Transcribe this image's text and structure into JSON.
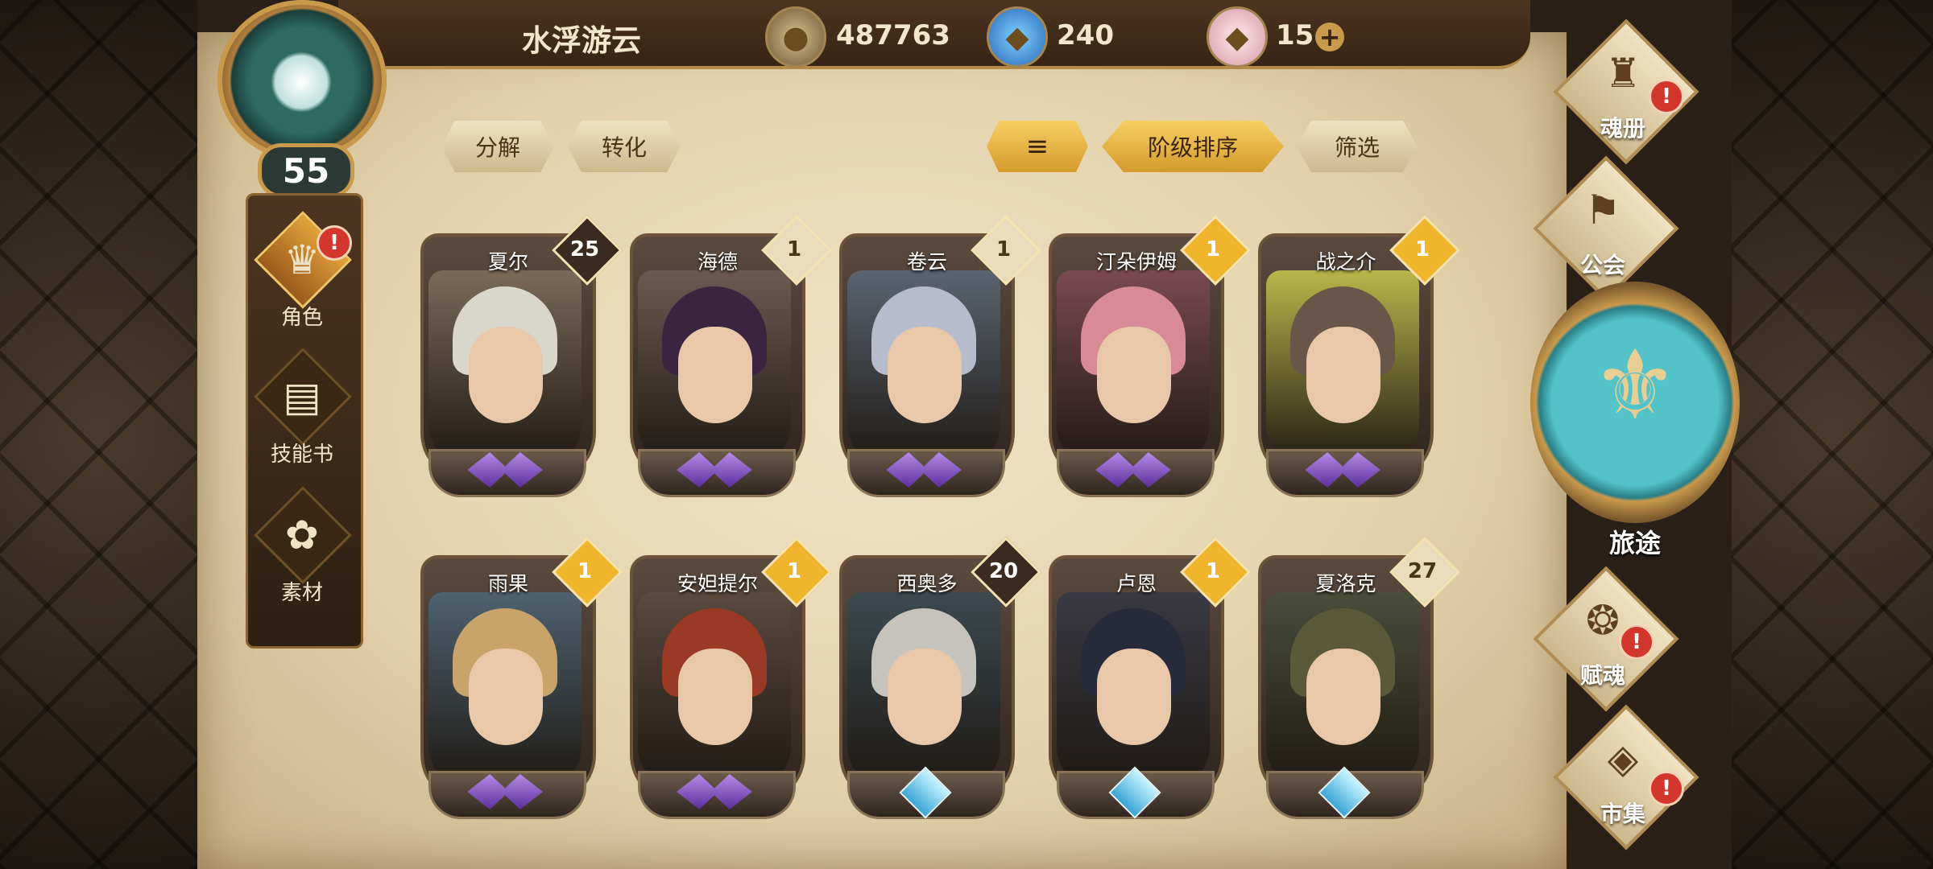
{
  "player": {
    "name": "水浮游云",
    "level": "55"
  },
  "currencies": [
    {
      "icon": "gold-coin-icon",
      "value": "487763"
    },
    {
      "icon": "blue-crystal-icon",
      "value": "240"
    },
    {
      "icon": "pink-gem-icon",
      "value": "15"
    }
  ],
  "left_nav": [
    {
      "label": "角色",
      "icon": "helmet-icon",
      "active": true,
      "alert": true
    },
    {
      "label": "技能书",
      "icon": "book-icon",
      "active": false,
      "alert": false
    },
    {
      "label": "素材",
      "icon": "material-icon",
      "active": false,
      "alert": false
    }
  ],
  "toolbar": {
    "decompose": "分解",
    "convert": "转化",
    "sort_icon": "sort-icon",
    "sort_by_rank": "阶级排序",
    "filter": "筛选"
  },
  "cards": [
    {
      "name": "夏尔",
      "rank": "25",
      "rank_color": "#3a2a20",
      "gem": "purple",
      "hair": "#d9d6cc",
      "bg": "#7a6a58"
    },
    {
      "name": "海德",
      "rank": "1",
      "rank_color": "#e9dcbc",
      "gem": "purple",
      "hair": "#3a2440",
      "bg": "#6c5a52"
    },
    {
      "name": "卷云",
      "rank": "1",
      "rank_color": "#e9dcbc",
      "gem": "purple",
      "hair": "#b7bccc",
      "bg": "#5a6470"
    },
    {
      "name": "汀朵伊姆",
      "rank": "1",
      "rank_color": "#f0b52c",
      "gem": "purple",
      "hair": "#d88a96",
      "bg": "#7a4a52"
    },
    {
      "name": "战之介",
      "rank": "1",
      "rank_color": "#f0b52c",
      "gem": "purple",
      "hair": "#6a5648",
      "bg": "#b9b64a"
    },
    {
      "name": "雨果",
      "rank": "1",
      "rank_color": "#f0b52c",
      "gem": "purple",
      "hair": "#c9a46a",
      "bg": "#4e6270"
    },
    {
      "name": "安妲提尔",
      "rank": "1",
      "rank_color": "#f0b52c",
      "gem": "purple",
      "hair": "#9a3a24",
      "bg": "#5a4a40"
    },
    {
      "name": "西奥多",
      "rank": "20",
      "rank_color": "#3a2a20",
      "gem": "blue",
      "hair": "#c6c2bc",
      "bg": "#3c4a50"
    },
    {
      "name": "卢恩",
      "rank": "1",
      "rank_color": "#f0b52c",
      "gem": "blue",
      "hair": "#262a3a",
      "bg": "#3a3a44"
    },
    {
      "name": "夏洛克",
      "rank": "27",
      "rank_color": "#e9dcbc",
      "gem": "blue",
      "hair": "#5a5a3a",
      "bg": "#4a4e3a"
    }
  ],
  "right_nav": [
    {
      "label": "魂册",
      "icon": "soul-book-icon",
      "alert": true
    },
    {
      "label": "公会",
      "icon": "guild-icon",
      "alert": false
    },
    {
      "label": "旅途",
      "icon": "journey-icon",
      "alert": false
    },
    {
      "label": "赋魂",
      "icon": "soul-infuse-icon",
      "alert": true
    },
    {
      "label": "市集",
      "icon": "market-icon",
      "alert": true
    }
  ],
  "colors": {
    "accent_gold": "#f0b52c",
    "alert_red": "#d3362c",
    "parchment": "#e3d2ad"
  }
}
